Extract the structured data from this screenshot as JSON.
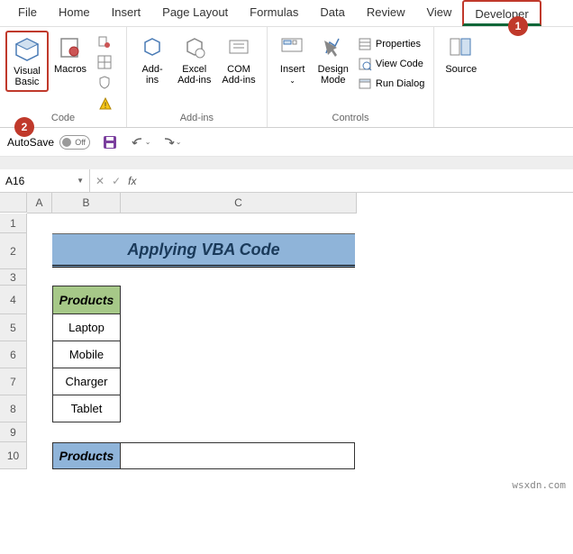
{
  "tabs": [
    "File",
    "Home",
    "Insert",
    "Page Layout",
    "Formulas",
    "Data",
    "Review",
    "View",
    "Developer"
  ],
  "ribbon": {
    "code": {
      "visual_basic": "Visual\nBasic",
      "macros": "Macros",
      "label": "Code"
    },
    "addins": {
      "addins": "Add-\nins",
      "excel_addins": "Excel\nAdd-ins",
      "com_addins": "COM\nAdd-ins",
      "label": "Add-ins"
    },
    "controls": {
      "insert": "Insert",
      "design_mode": "Design\nMode",
      "properties": "Properties",
      "view_code": "View Code",
      "run_dialog": "Run Dialog",
      "label": "Controls"
    },
    "xml": {
      "source": "Source"
    }
  },
  "quick_access": {
    "autosave": "AutoSave",
    "toggle_state": "Off"
  },
  "formula_bar": {
    "name_box": "A16",
    "cancel": "✕",
    "confirm": "✓",
    "fx": "fx"
  },
  "cols": [
    "A",
    "B",
    "C"
  ],
  "rows": [
    "1",
    "2",
    "3",
    "4",
    "5",
    "6",
    "7",
    "8",
    "9",
    "10"
  ],
  "sheet": {
    "title": "Applying VBA Code",
    "products_header": "Products",
    "products": [
      "Laptop",
      "Mobile",
      "Charger",
      "Tablet"
    ],
    "products_header2": "Products"
  },
  "callouts": {
    "one": "1",
    "two": "2"
  },
  "watermark": "wsxdn.com"
}
